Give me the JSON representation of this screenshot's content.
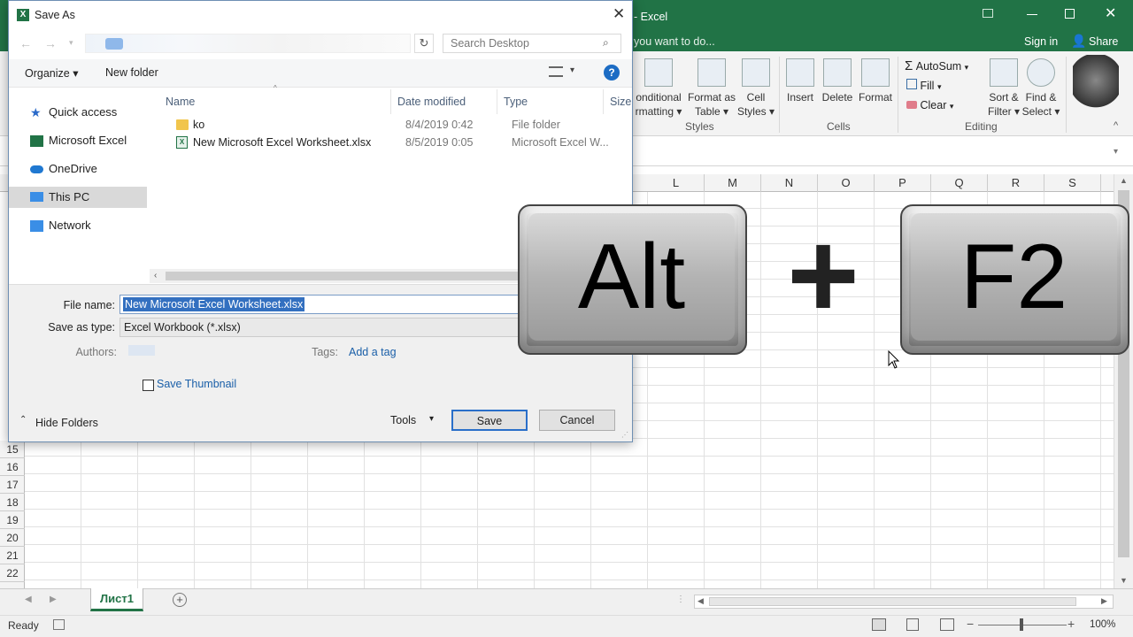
{
  "excel": {
    "title": "- Excel",
    "tell_me": "you want to do...",
    "signin": "Sign in",
    "share": "Share",
    "ribbon": {
      "styles": {
        "conditional_line1": "onditional",
        "conditional_line2": "rmatting ▾",
        "format_table_line1": "Format as",
        "format_table_line2": "Table ▾",
        "cell_styles_line1": "Cell",
        "cell_styles_line2": "Styles ▾",
        "group": "Styles"
      },
      "cells": {
        "insert": "Insert",
        "delete": "Delete",
        "format": "Format",
        "group": "Cells"
      },
      "editing": {
        "autosum": "AutoSum",
        "fill": "Fill",
        "clear": "Clear",
        "sort_line1": "Sort &",
        "sort_line2": "Filter ▾",
        "find_line1": "Find &",
        "find_line2": "Select ▾",
        "group": "Editing"
      }
    },
    "columns": [
      "L",
      "M",
      "N",
      "O",
      "P",
      "Q",
      "R",
      "S"
    ],
    "rows": [
      "15",
      "16",
      "17",
      "18",
      "19",
      "20",
      "21",
      "22"
    ],
    "sheet_tab": "Лист1",
    "status": "Ready",
    "zoom": "100%"
  },
  "dialog": {
    "title": "Save As",
    "search_placeholder": "Search Desktop",
    "organize": "Organize ▾",
    "new_folder": "New folder",
    "help": "?",
    "nav": [
      "Quick access",
      "Microsoft Excel",
      "OneDrive",
      "This PC",
      "Network"
    ],
    "columns": {
      "name": "Name",
      "date": "Date modified",
      "type": "Type",
      "size": "Size"
    },
    "files": [
      {
        "name": "ko",
        "date": "8/4/2019 0:42",
        "type": "File folder"
      },
      {
        "name": "New Microsoft Excel Worksheet.xlsx",
        "date": "8/5/2019 0:05",
        "type": "Microsoft Excel W..."
      }
    ],
    "file_name_label": "File name:",
    "file_name_value": "New Microsoft Excel Worksheet.xlsx",
    "save_type_label": "Save as type:",
    "save_type_value": "Excel Workbook (*.xlsx)",
    "authors_label": "Authors:",
    "tags_label": "Tags:",
    "tags_link": "Add a tag",
    "thumbnail_label": "Save Thumbnail",
    "hide_folders": "Hide Folders",
    "tools": "Tools",
    "save": "Save",
    "cancel": "Cancel"
  },
  "overlay": {
    "key1": "Alt",
    "plus": "+",
    "key2": "F2"
  },
  "colors": {
    "excel_green": "#217346",
    "selection": "#3370c0",
    "link": "#1a5fa8"
  }
}
